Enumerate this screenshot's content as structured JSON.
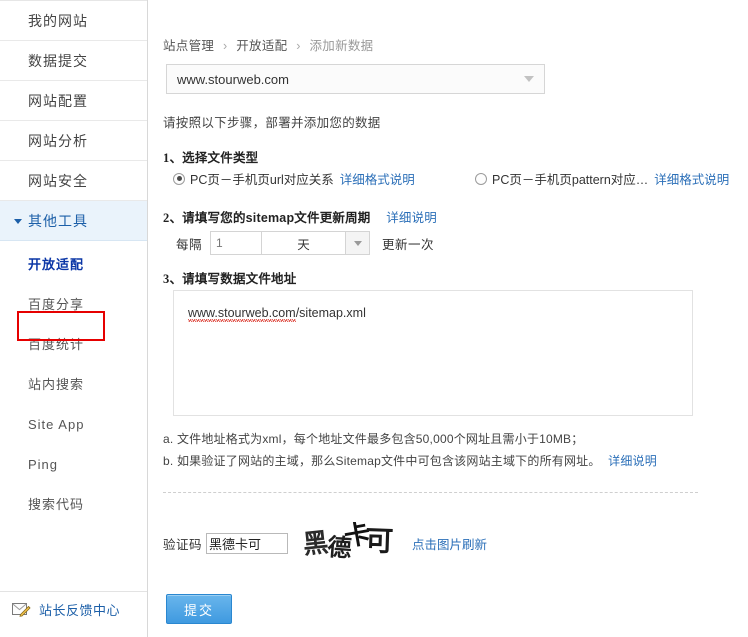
{
  "sidebar": {
    "items": [
      {
        "label": "我的网站"
      },
      {
        "label": "数据提交"
      },
      {
        "label": "网站配置"
      },
      {
        "label": "网站分析"
      },
      {
        "label": "网站安全"
      }
    ],
    "active_group": "其他工具",
    "sub_items": [
      {
        "label": "开放适配",
        "selected": true
      },
      {
        "label": "百度分享",
        "selected": false
      },
      {
        "label": "百度统计",
        "selected": false
      },
      {
        "label": "站内搜索",
        "selected": false
      },
      {
        "label": "Site App",
        "selected": false
      },
      {
        "label": "Ping",
        "selected": false
      },
      {
        "label": "搜索代码",
        "selected": false
      }
    ],
    "feedback": {
      "label": "站长反馈中心",
      "icon": "mail-pencil-icon"
    },
    "highlight_color": "#e60000",
    "active_bg": "#eaf3fb",
    "link_color": "#1c5fa8"
  },
  "breadcrumb": {
    "item1": "站点管理",
    "sep": "›",
    "item2": "开放适配",
    "item3": "添加新数据"
  },
  "site_select": {
    "value": "www.stourweb.com",
    "icon": "chevron-down-icon"
  },
  "main": {
    "intro": "请按照以下步骤，部署并添加您的数据",
    "step1": {
      "num": "1、",
      "title": "选择文件类型",
      "options": [
        {
          "label": "PC页－手机页url对应关系",
          "link": "详细格式说明",
          "checked": true
        },
        {
          "label": "PC页－手机页pattern对应…",
          "link": "详细格式说明",
          "checked": false
        }
      ]
    },
    "step2": {
      "num": "2、",
      "title": "请填写您的sitemap文件更新周期",
      "link": "详细说明",
      "prefix": "每隔",
      "interval_value": "1",
      "unit": "天",
      "suffix": "更新一次"
    },
    "step3": {
      "num": "3、",
      "title": "请填写数据文件地址",
      "url_spell": "www.stourweb.com",
      "url_rest": "/sitemap.xml"
    },
    "notes": {
      "a": "a. 文件地址格式为xml，每个地址文件最多包含50,000个网址且需小于10MB；",
      "b": "b. 如果验证了网站的主域，那么Sitemap文件中可包含该网站主域下的所有网址。",
      "b_link": "详细说明"
    },
    "captcha": {
      "label": "验证码",
      "value": "黑德卡可",
      "image_text": "黑德卡可",
      "refresh_link": "点击图片刷新"
    },
    "submit_label": "提交",
    "submit_color": "#3f9ae0"
  }
}
